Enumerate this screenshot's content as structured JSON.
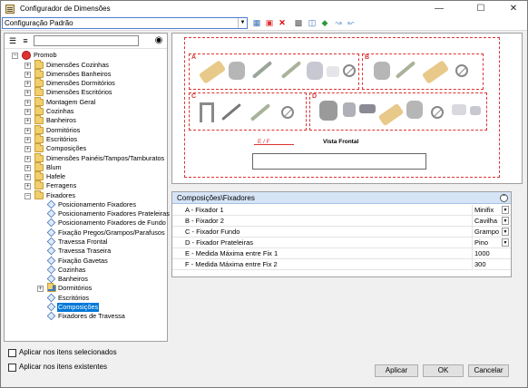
{
  "window": {
    "title": "Configurador de Dimensões"
  },
  "toolbar": {
    "config_value": "Configuração Padrão"
  },
  "tree": {
    "root": "Promob",
    "items": [
      "Dimensões Cozinhas",
      "Dimensões Banheiros",
      "Dimensões Dormitórios",
      "Dimensões Escritórios",
      "Montagem Geral",
      "Cozinhas",
      "Banheiros",
      "Dormitórios",
      "Escritórios",
      "Composições",
      "Dimensões Painéis/Tampos/Tamburatos",
      "Blum",
      "Hafele",
      "Ferragens",
      "Fixadores"
    ],
    "children": [
      "Posicionamento Fixadores",
      "Posicionamento Fixadores Prateleiras",
      "Posicionamento Fixadores de Fundo",
      "Fixação Pregos/Grampos/Parafusos",
      "Travessa Frontal",
      "Travessa Traseira",
      "Fixação Gavetas",
      "Cozinhas",
      "Banheiros",
      "Dormitórios",
      "Escritórios",
      "Composições",
      "Fixadores de Travessa"
    ]
  },
  "image": {
    "groups": [
      "A",
      "B",
      "C",
      "D"
    ],
    "tag": "E / F",
    "caption": "Vista Frontal"
  },
  "props": {
    "header": "Composições\\Fixadores",
    "rows": [
      {
        "name": "A - Fixador 1",
        "value": "Minifix"
      },
      {
        "name": "B - Fixador 2",
        "value": "Cavilha"
      },
      {
        "name": "C - Fixador Fundo",
        "value": "Grampo"
      },
      {
        "name": "D - Fixador Prateleiras",
        "value": "Pino"
      },
      {
        "name": "E - Medida Máxima entre Fix 1",
        "value": "1000"
      },
      {
        "name": "F - Medida Máxima entre Fix 2",
        "value": "300"
      }
    ]
  },
  "options": {
    "selected": "Aplicar nos itens selecionados",
    "existing": "Aplicar nos itens existentes"
  },
  "buttons": {
    "apply": "Aplicar",
    "ok": "OK",
    "cancel": "Cancelar"
  },
  "colors": {
    "accent": "#0078d7",
    "highlight": "#d33333"
  }
}
